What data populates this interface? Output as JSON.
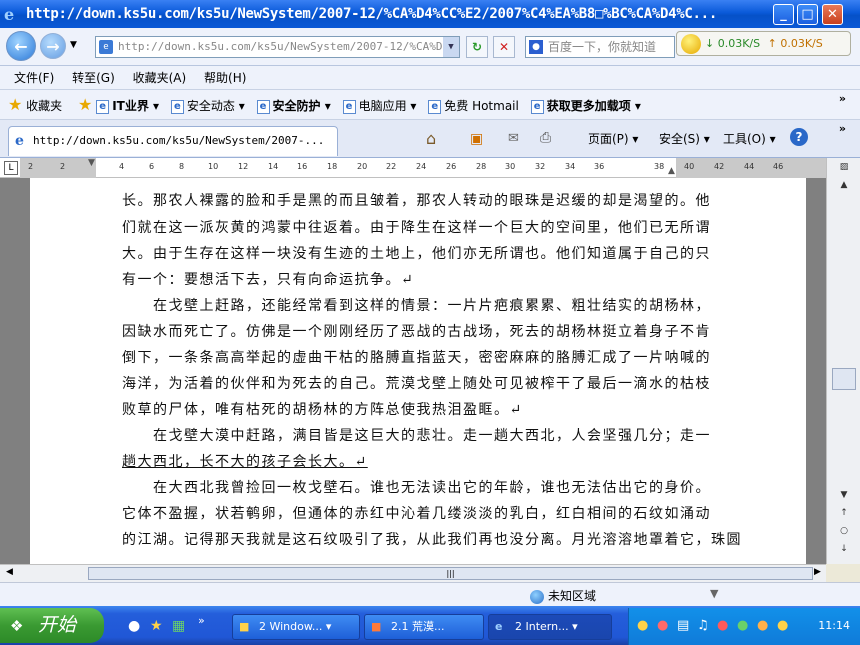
{
  "window": {
    "title": "http://down.ks5u.com/ks5u/NewSystem/2007-12/%CA%D4%CC%E2/2007%C4%EA%B8□%BC%CA%D4%C...",
    "min": "_",
    "max": "□",
    "close": "✕"
  },
  "addressbar": {
    "url": "http://down.ks5u.com/ks5u/NewSystem/2007-12/%CA%D",
    "search_placeholder": "百度一下，你就知道",
    "speed_down": "↓ 0.03K/S",
    "speed_up": "↑ 0.03K/S"
  },
  "menu": [
    "文件(F)",
    "转至(G)",
    "收藏夹(A)",
    "帮助(H)"
  ],
  "favorites": {
    "label": "收藏夹",
    "items": [
      "IT业界 ▾",
      "安全动态 ▾",
      "安全防护 ▾",
      "电脑应用 ▾",
      "免费 Hotmail",
      "获取更多加载项 ▾"
    ]
  },
  "tab": {
    "title": "http://down.ks5u.com/ks5u/NewSystem/2007-..."
  },
  "commands": [
    "页面(P) ▾",
    "安全(S) ▾",
    "工具(O) ▾"
  ],
  "ruler": [
    "2",
    "2",
    "4",
    "6",
    "8",
    "10",
    "12",
    "14",
    "16",
    "18",
    "20",
    "22",
    "24",
    "26",
    "28",
    "30",
    "32",
    "34",
    "36",
    "38",
    "40",
    "42",
    "44",
    "46"
  ],
  "document": {
    "lines": [
      "长。那农人裸露的脸和手是黑的而且皱着，那农人转动的眼珠是迟缓的却是渴望的。他",
      "们就在这一派灰黄的鸿蒙中往返着。由于降生在这样一个巨大的空间里，他们已无所谓",
      "大。由于生存在这样一块没有生迹的土地上，他们亦无所谓也。他们知道属于自己的只",
      "有一个：要想活下去，只有向命运抗争。↵",
      "　　在戈壁上赶路，还能经常看到这样的情景：一片片疤痕累累、粗壮结实的胡杨林，",
      "因缺水而死亡了。仿佛是一个刚刚经历了恶战的古战场，死去的胡杨林挺立着身子不肯",
      "倒下，一条条高高举起的虚曲干枯的胳膊直指蓝天，密密麻麻的胳膊汇成了一片呐喊的",
      "海洋，为活着的伙伴和为死去的自己。荒漠戈壁上随处可见被榨干了最后一滴水的枯枝",
      "败草的尸体，唯有枯死的胡杨林的方阵总使我热泪盈眶。↵",
      "　　在戈壁大漠中赶路，满目皆是这巨大的悲壮。走一趟大西北，人会坚强几分；走一",
      "趟大西北，长不大的孩子会长大。↵",
      "　　在大西北我曾捡回一枚戈壁石。谁也无法读出它的年龄，谁也无法估出它的身价。",
      "它体不盈握，状若鹌卵，但通体的赤红中沁着几缕淡淡的乳白，红白相间的石纹如涌动",
      "的江湖。记得那天我就是这石纹吸引了我，从此我们再也没分离。月光溶溶地罩着它，珠圆"
    ]
  },
  "statusbar": {
    "zone": "未知区域"
  },
  "taskbar": {
    "start": "开始",
    "buttons": [
      "2 Window...",
      "2.1 荒漠...",
      "2 Intern..."
    ],
    "clock": "11:14"
  }
}
